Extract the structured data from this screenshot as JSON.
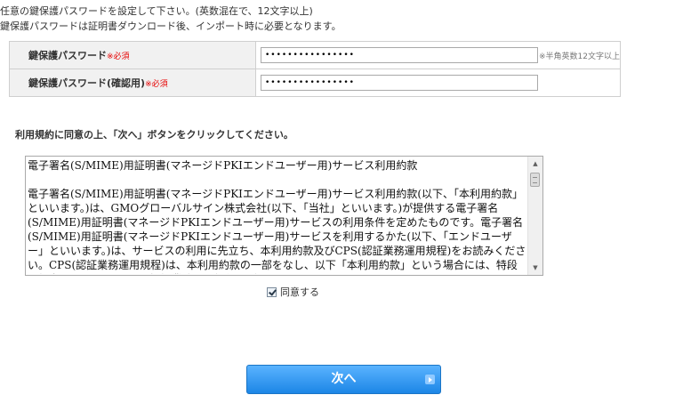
{
  "intro": {
    "line1": "任意の鍵保護パスワードを設定して下さい。(英数混在で、12文字以上)",
    "line2": "鍵保護パスワードは証明書ダウンロード後、インポート時に必要となります。"
  },
  "password_fields": [
    {
      "label": "鍵保護パスワード",
      "required": "※必須",
      "value": "••••••••••••••••",
      "note": "※半角英数12文字以上"
    },
    {
      "label": "鍵保護パスワード(確認用)",
      "required": "※必須",
      "value": "••••••••••••••••"
    }
  ],
  "terms": {
    "instruction": "利用規約に同意の上、「次へ」ボタンをクリックしてください。",
    "title": "電子署名(S/MIME)用証明書(マネージドPKIエンドユーザー用)サービス利用約款",
    "body": "電子署名(S/MIME)用証明書(マネージドPKIエンドユーザー用)サービス利用約款(以下、「本利用約款」といいます。)は、GMOグローバルサイン株式会社(以下、「当社」といいます。)が提供する電子署名(S/MIME)用証明書(マネージドPKIエンドユーザー用)サービスの利用条件を定めたものです。電子署名(S/MIME)用証明書(マネージドPKIエンドユーザー用)サービスを利用するかた(以下、「エンドユーザー」といいます。)は、サービスの利用に先立ち、本利用約款及びCPS(認証業務運用規程)をお読みください。CPS(認証業務運用規程)は、本利用約款の一部をなし、以下「本利用約款」という場合には、特段の規定のない限り、CPS(認証業務運用規程)を含むものとします。"
  },
  "agree": {
    "label": "同意する",
    "checked": true
  },
  "next_button": {
    "label": "次へ"
  },
  "colors": {
    "required": "#e60000",
    "button": "#1c86e6"
  }
}
